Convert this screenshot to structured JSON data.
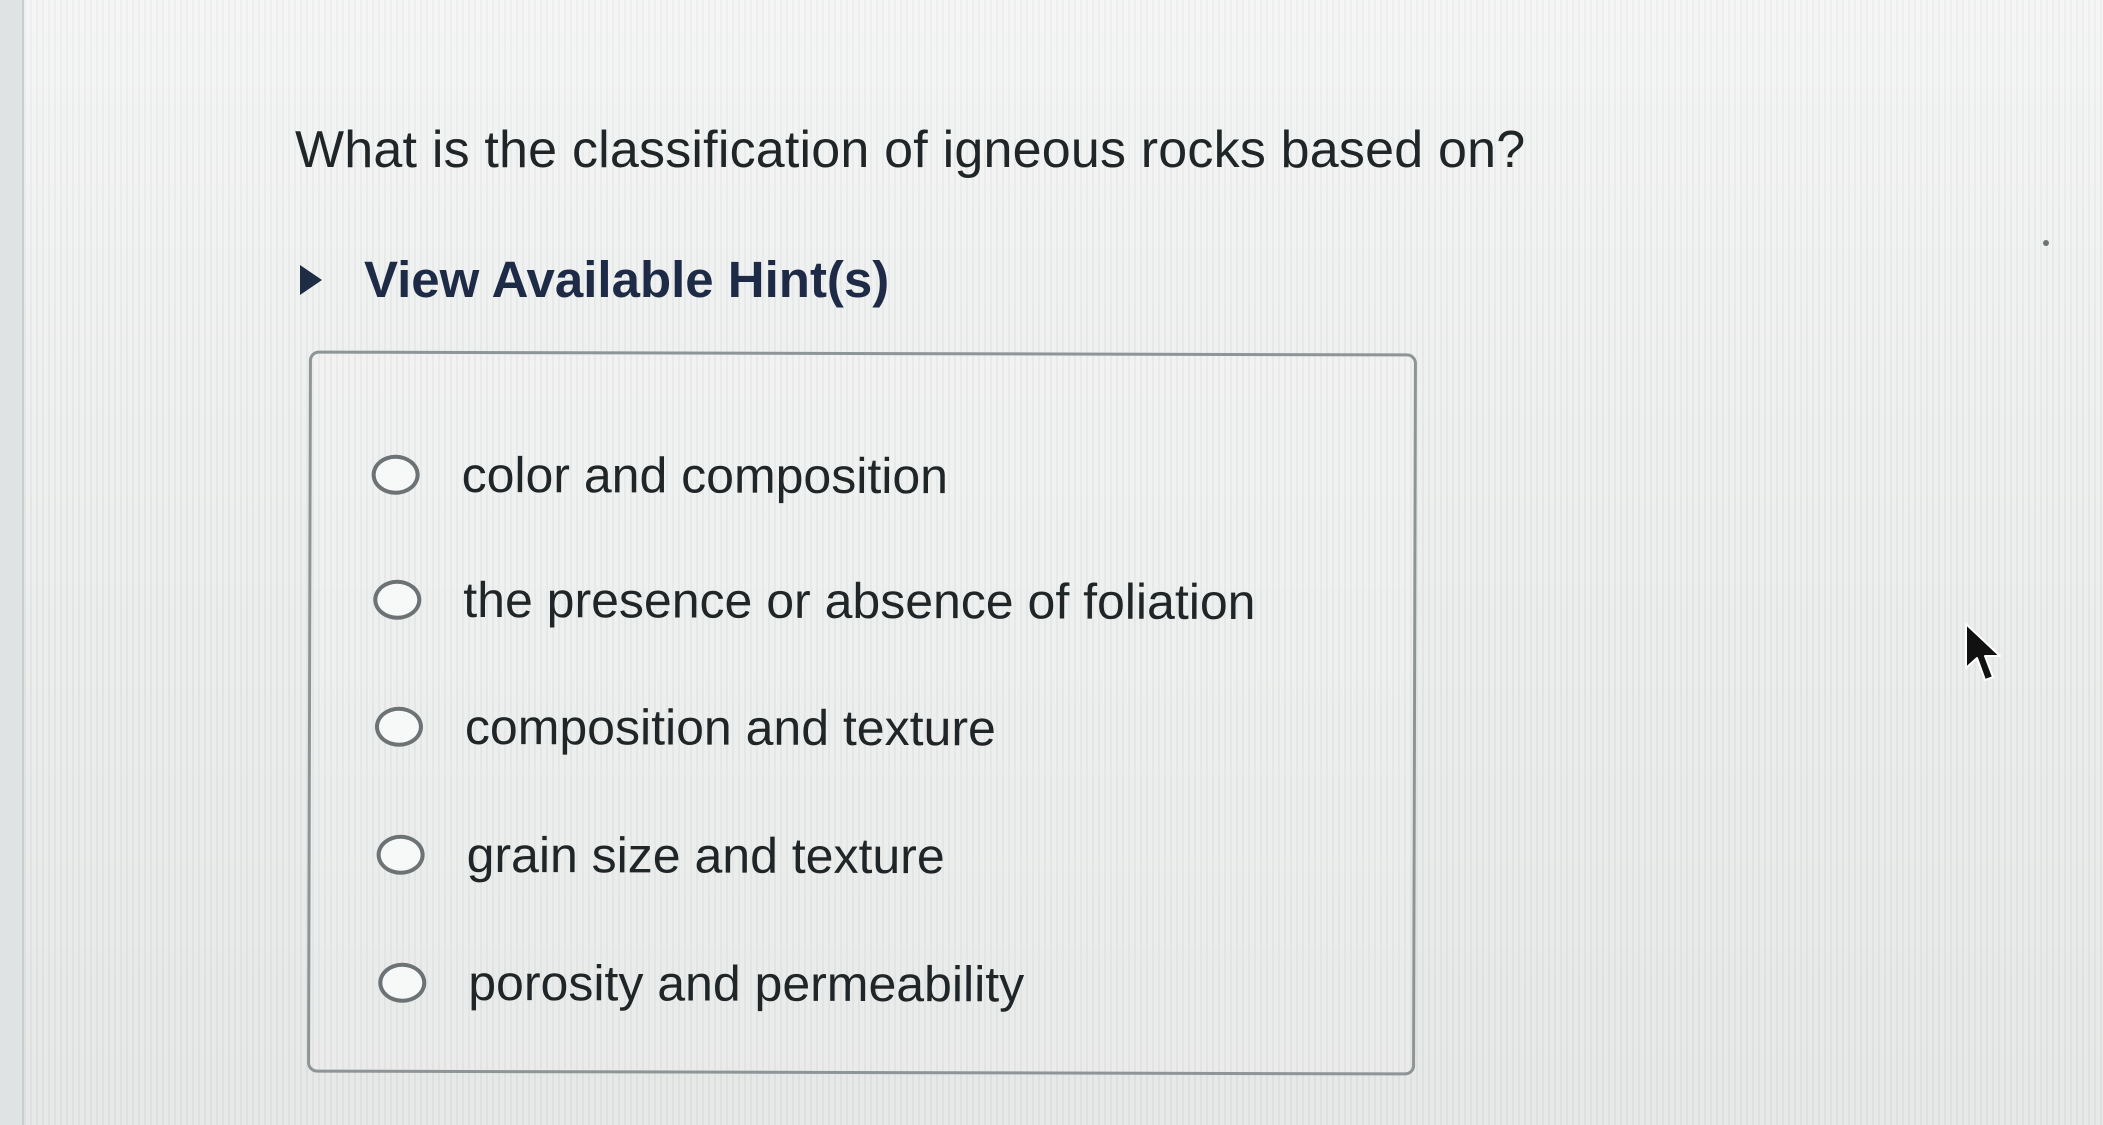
{
  "question": {
    "text": "What is the classification of igneous rocks based on?"
  },
  "hints": {
    "label": "View Available Hint(s)",
    "icon": "caret-right-icon"
  },
  "options": [
    {
      "label": "color and composition",
      "selected": false
    },
    {
      "label": "the presence or absence of foliation",
      "selected": false
    },
    {
      "label": "composition and texture",
      "selected": false
    },
    {
      "label": "grain size and texture",
      "selected": false
    },
    {
      "label": "porosity and permeability",
      "selected": false
    }
  ],
  "cursor": {
    "icon": "mouse-pointer-icon"
  },
  "colors": {
    "text": "#202628",
    "hint_text": "#1e2b46",
    "box_border": "#8e9596",
    "radio_border": "#6d7375",
    "background": "#eef0ef"
  }
}
